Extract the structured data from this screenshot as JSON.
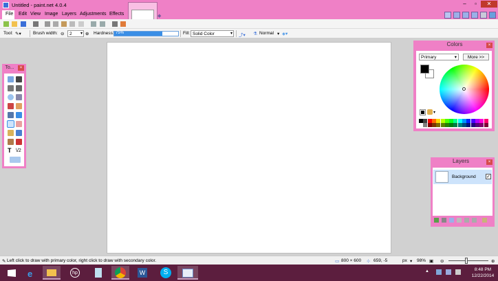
{
  "window": {
    "title": "Untitled - paint.net 4.0.4",
    "min_glyph": "–",
    "max_glyph": "▫",
    "close_glyph": "✕"
  },
  "menu": [
    "File",
    "Edit",
    "View",
    "Image",
    "Layers",
    "Adjustments",
    "Effects"
  ],
  "toolbar": {
    "tool_label": "Tool:",
    "brush_width_label": "Brush width:",
    "brush_width_value": "2",
    "hardness_label": "Hardness:",
    "hardness_value": "75%",
    "hardness_fraction": 0.75,
    "fill_label": "Fill:",
    "fill_value": "Solid Color",
    "blend_mode": "Normal"
  },
  "tools_panel": {
    "title": "To..."
  },
  "colors_panel": {
    "title": "Colors",
    "select_value": "Primary",
    "more_label": "More >>",
    "primary_color": "#000000",
    "secondary_color": "#ffffff",
    "palette_top": [
      "#000000",
      "#404040",
      "#ff0000",
      "#ff6a00",
      "#ffd800",
      "#b6ff00",
      "#4cff00",
      "#00ff21",
      "#00ff90",
      "#00ffff",
      "#0094ff",
      "#0026ff",
      "#4800ff",
      "#b200ff",
      "#ff00dc",
      "#ff006e"
    ],
    "palette_bottom": [
      "#ffffff",
      "#808080",
      "#7f0000",
      "#7f3300",
      "#7f6a00",
      "#5b7f00",
      "#267f00",
      "#007f0e",
      "#007f46",
      "#007f7f",
      "#004a7f",
      "#00137f",
      "#21007f",
      "#57007f",
      "#7f006e",
      "#7f0037"
    ]
  },
  "layers_panel": {
    "title": "Layers",
    "layers": [
      {
        "name": "Background",
        "visible": true
      }
    ]
  },
  "statusbar": {
    "hint": "Left click to draw with primary color, right click to draw with secondary color.",
    "image_size": "800 × 600",
    "cursor_pos": "659, -5",
    "units": "px",
    "zoom": "98%"
  },
  "taskbar": {
    "time": "8:48 PM",
    "date": "12/22/2014",
    "apps": [
      "windows-start",
      "internet-explorer",
      "file-explorer",
      "hp",
      "notepad",
      "chrome",
      "word",
      "skype",
      "paint-net"
    ]
  }
}
